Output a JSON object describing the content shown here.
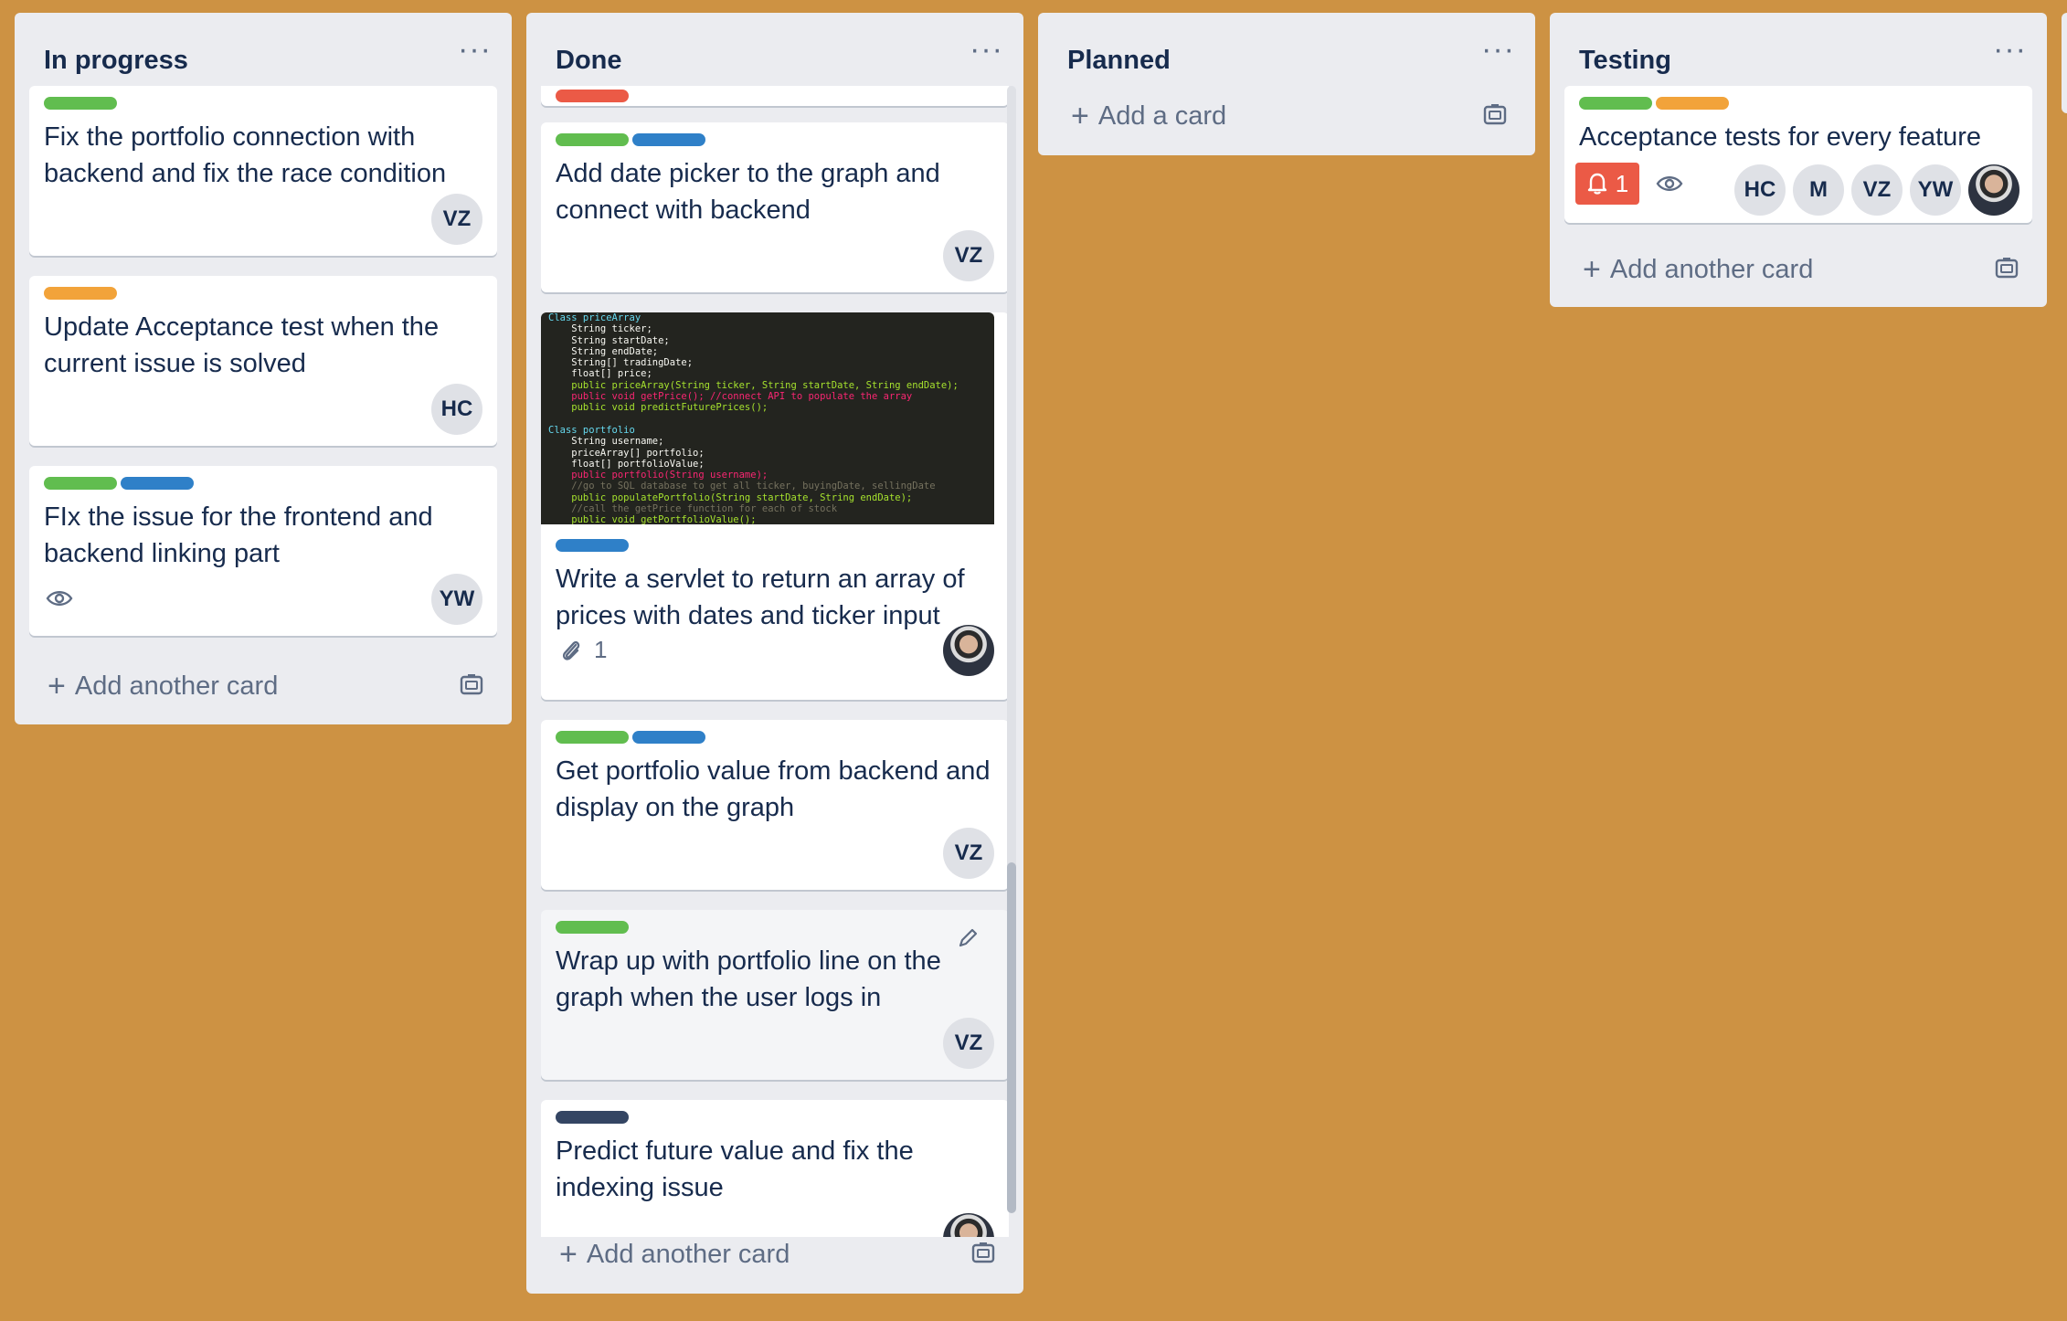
{
  "board": {
    "lists": [
      {
        "title": "In progress",
        "add_label": "Add another card",
        "cards": [
          {
            "title": "Fix the portfolio connection with backend and fix the race condition",
            "labels": [
              "#61bd4f"
            ],
            "member": "VZ"
          },
          {
            "title": "Update Acceptance test when the current issue is solved",
            "labels": [
              "#f2a33a"
            ],
            "member": "HC"
          },
          {
            "title": "FIx the issue for the frontend and backend linking part",
            "labels": [
              "#61bd4f",
              "#2f80c8"
            ],
            "member": "YW",
            "badges": [
              "eye-icon"
            ]
          }
        ]
      },
      {
        "title": "Done",
        "add_label": "Add another card",
        "cards": [
          {
            "title": "Add date picker to the graph and connect with backend",
            "labels": [
              "#61bd4f",
              "#2f80c8"
            ],
            "member": "VZ"
          },
          {
            "title": "Write a servlet to return an array of prices with dates and ticker input",
            "labels": [
              "#2f80c8"
            ],
            "attachments": "1",
            "has_cover": true
          },
          {
            "title": "Get portfolio value from backend and display on the graph",
            "labels": [
              "#61bd4f",
              "#2f80c8"
            ],
            "member": "VZ"
          },
          {
            "title": "Wrap up with portfolio line on the graph when the user logs in",
            "labels": [
              "#61bd4f"
            ],
            "member": "VZ"
          },
          {
            "title": "Predict future value and fix the indexing issue",
            "labels": [
              "#344563"
            ]
          }
        ],
        "code_lines": [
          "Class priceArray",
          "    String ticker;",
          "    String startDate;",
          "    String endDate;",
          "    String[] tradingDate;",
          "    float[] price;",
          "    public priceArray(String ticker, String startDate, String endDate);",
          "    public void getPrice(); //connect API to populate the array",
          "    public void predictFuturePrices();",
          "",
          "Class portfolio",
          "    String username;",
          "    priceArray[] portfolio;",
          "    float[] portfolioValue;",
          "    public portfolio(String username);",
          "    //go to SQL database to get all ticker, buyingDate, sellingDate",
          "    public populatePortfolio(String startDate, String endDate);",
          "    //call the getPrice function for each of stock",
          "    public void getPortfolioValue();"
        ]
      },
      {
        "title": "Planned",
        "add_label": "Add a card",
        "cards": []
      },
      {
        "title": "Testing",
        "add_label": "Add another card",
        "cards": [
          {
            "title": "Acceptance tests for every feature",
            "labels": [
              "#61bd4f",
              "#f2a33a"
            ],
            "notification_count": "1",
            "members": [
              "HC",
              "M",
              "VZ",
              "YW"
            ]
          }
        ]
      }
    ],
    "menu_glyph": "···",
    "accent_colors": {
      "background": "#cd9243",
      "list": "#ebecf0",
      "due_badge": "#eb5a46"
    }
  }
}
